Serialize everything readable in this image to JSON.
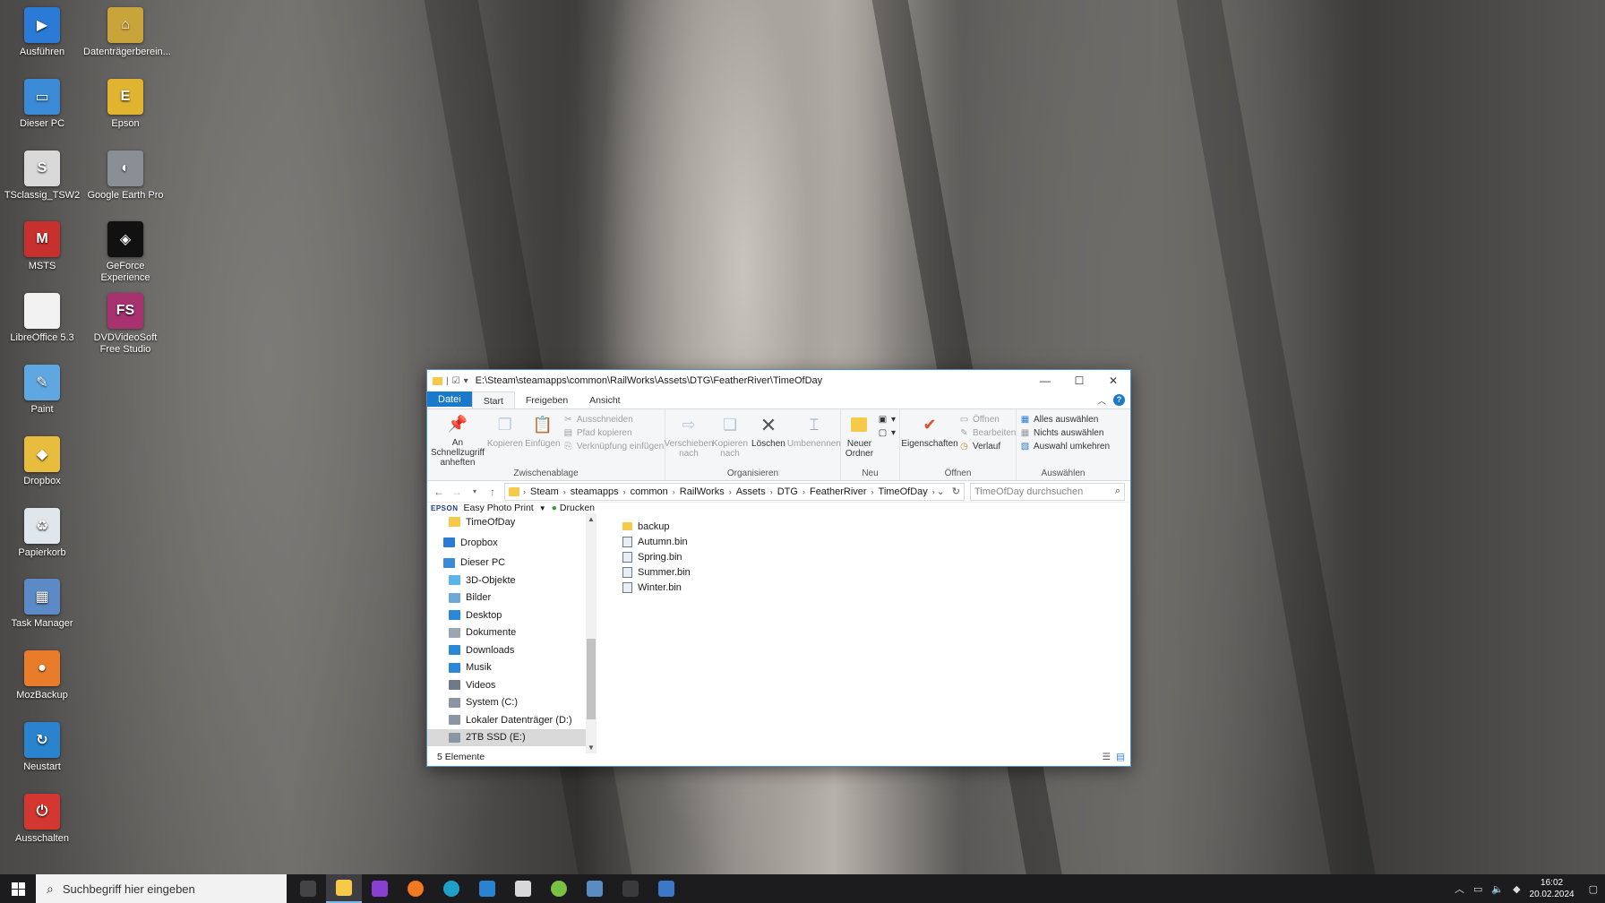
{
  "desktop": {
    "icons": [
      {
        "label": "Ausführen",
        "color": "#2b7bd6",
        "glyph": "▶"
      },
      {
        "label": "Datenträgerberein...",
        "color": "#c9a43a",
        "glyph": "⌂"
      },
      {
        "label": "Dieser PC",
        "color": "#3a8ad8",
        "glyph": "▭"
      },
      {
        "label": "Epson",
        "color": "#e1b430",
        "glyph": "E"
      },
      {
        "label": "TSclassig_TSW2",
        "color": "#d9d9d9",
        "glyph": "S"
      },
      {
        "label": "Google Earth Pro",
        "color": "#8a8f96",
        "glyph": "◐"
      },
      {
        "label": "MSTS",
        "color": "#c8302d",
        "glyph": "M"
      },
      {
        "label": "GeForce Experience",
        "color": "#111111",
        "glyph": "◈"
      },
      {
        "label": "LibreOffice 5.3",
        "color": "#f2f2f2",
        "glyph": " "
      },
      {
        "label": "DVDVideoSoft Free Studio",
        "color": "#a8316f",
        "glyph": "FS"
      },
      {
        "label": "Paint",
        "color": "#5ea7e0",
        "glyph": "✎"
      },
      {
        "label": "Dropbox",
        "color": "#e8bd3d",
        "glyph": "◆"
      },
      {
        "label": "Papierkorb",
        "color": "#dfe7ec",
        "glyph": "♻"
      },
      {
        "label": "Task Manager",
        "color": "#5b8ac7",
        "glyph": "▦"
      },
      {
        "label": "MozBackup",
        "color": "#e87c2b",
        "glyph": "●"
      },
      {
        "label": "Neustart",
        "color": "#2a83cf",
        "glyph": "↻"
      },
      {
        "label": "Ausschalten",
        "color": "#d4372f",
        "glyph": "⏻"
      }
    ]
  },
  "window": {
    "title_path": "E:\\Steam\\steamapps\\common\\RailWorks\\Assets\\DTG\\FeatherRiver\\TimeOfDay",
    "controls": {
      "minimize": "—",
      "maximize": "☐",
      "close": "✕"
    },
    "tabs": [
      {
        "label": "Datei"
      },
      {
        "label": "Start"
      },
      {
        "label": "Freigeben"
      },
      {
        "label": "Ansicht"
      }
    ],
    "ribbon": {
      "clipboard": {
        "name": "Zwischenablage",
        "pin": "An Schnellzugriff anheften",
        "copy": "Kopieren",
        "paste": "Einfügen",
        "cut": "Ausschneiden",
        "copy_path": "Pfad kopieren",
        "paste_link": "Verknüpfung einfügen"
      },
      "organize": {
        "name": "Organisieren",
        "move": "Verschieben nach",
        "copy_to": "Kopieren nach",
        "delete": "Löschen",
        "rename": "Umbenennen"
      },
      "new": {
        "name": "Neu",
        "new_folder": "Neuer Ordner"
      },
      "open": {
        "name": "Öffnen",
        "properties": "Eigenschaften",
        "open": "Öffnen",
        "edit": "Bearbeiten",
        "history": "Verlauf"
      },
      "select": {
        "name": "Auswählen",
        "select_all": "Alles auswählen",
        "select_none": "Nichts auswählen",
        "invert": "Auswahl umkehren"
      }
    },
    "breadcrumb": [
      "Steam",
      "steamapps",
      "common",
      "RailWorks",
      "Assets",
      "DTG",
      "FeatherRiver",
      "TimeOfDay"
    ],
    "search_placeholder": "TimeOfDay durchsuchen",
    "epson_bar": {
      "brand": "EPSON",
      "app": "Easy Photo Print",
      "print": "Drucken"
    },
    "nav_items": [
      {
        "label": "TimeOfDay",
        "color": "#f7c948",
        "indent": 1,
        "selected": false
      },
      {
        "label": "Dropbox",
        "color": "#2a7ad6",
        "indent": 0,
        "selected": false
      },
      {
        "label": "Dieser PC",
        "color": "#3a8ad8",
        "indent": 0,
        "selected": false
      },
      {
        "label": "3D-Objekte",
        "color": "#5bb5e8",
        "indent": 1,
        "selected": false
      },
      {
        "label": "Bilder",
        "color": "#6fa8d8",
        "indent": 1,
        "selected": false
      },
      {
        "label": "Desktop",
        "color": "#2b87d8",
        "indent": 1,
        "selected": false
      },
      {
        "label": "Dokumente",
        "color": "#9aa6b2",
        "indent": 1,
        "selected": false
      },
      {
        "label": "Downloads",
        "color": "#2b87d8",
        "indent": 1,
        "selected": false
      },
      {
        "label": "Musik",
        "color": "#2b87d8",
        "indent": 1,
        "selected": false
      },
      {
        "label": "Videos",
        "color": "#6e7a88",
        "indent": 1,
        "selected": false
      },
      {
        "label": "System (C:)",
        "color": "#8a96a3",
        "indent": 1,
        "selected": false
      },
      {
        "label": "Lokaler Datenträger (D:)",
        "color": "#8a96a3",
        "indent": 1,
        "selected": false
      },
      {
        "label": "2TB SSD (E:)",
        "color": "#8a96a3",
        "indent": 1,
        "selected": true
      }
    ],
    "files": [
      {
        "name": "backup",
        "type": "folder"
      },
      {
        "name": "Autumn.bin",
        "type": "bin"
      },
      {
        "name": "Spring.bin",
        "type": "bin"
      },
      {
        "name": "Summer.bin",
        "type": "bin"
      },
      {
        "name": "Winter.bin",
        "type": "bin"
      }
    ],
    "status": "5 Elemente"
  },
  "taskbar": {
    "search_placeholder": "Suchbegriff hier eingeben",
    "apps": [
      {
        "name": "task-view",
        "color": "#444444"
      },
      {
        "name": "file-explorer",
        "color": "#f7c948",
        "active": true
      },
      {
        "name": "app-purple",
        "color": "#8a3fd1"
      },
      {
        "name": "firefox",
        "color": "#f07a1d"
      },
      {
        "name": "edge",
        "color": "#1fa0c9"
      },
      {
        "name": "mail",
        "color": "#2a83cf"
      },
      {
        "name": "home-app",
        "color": "#d8d8d8"
      },
      {
        "name": "green-app",
        "color": "#7ac143"
      },
      {
        "name": "steam",
        "color": "#5a8cc2"
      },
      {
        "name": "ts-app",
        "color": "#3a3a3a"
      },
      {
        "name": "blue-app",
        "color": "#3c78c8"
      }
    ],
    "time": "16:02",
    "date": "20.02.2024"
  }
}
